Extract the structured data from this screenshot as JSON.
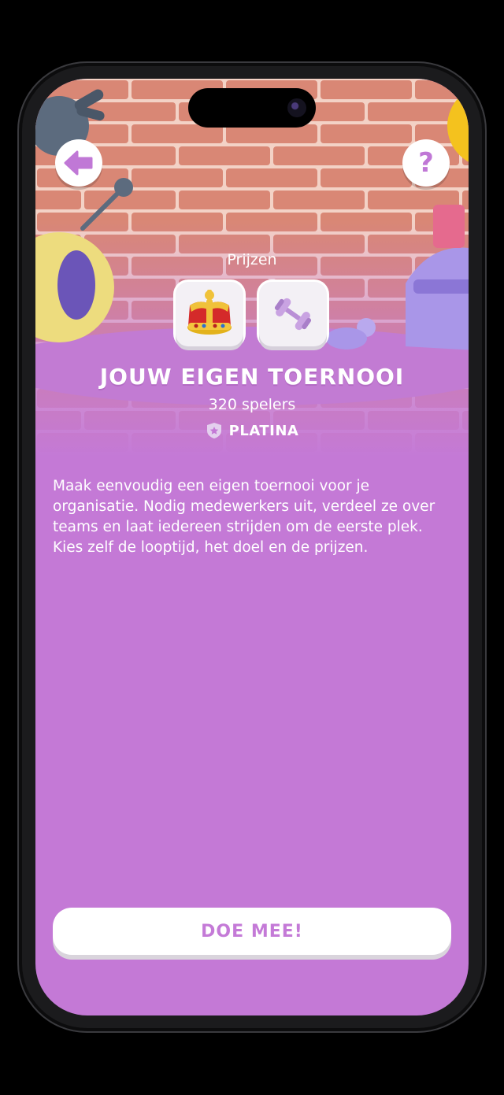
{
  "header": {
    "back_icon": "arrow-left-icon",
    "help_label": "?"
  },
  "prizes": {
    "label": "Prijzen",
    "items": [
      {
        "icon": "crown-icon"
      },
      {
        "icon": "dumbbell-icon"
      }
    ]
  },
  "tournament": {
    "title": "JOUW EIGEN TOERNOOI",
    "players": "320 spelers",
    "level": "PLATINA",
    "level_icon": "shield-star-icon",
    "description": "Maak eenvoudig een eigen toernooi voor je organisatie. Nodig medewerkers uit, verdeel ze over teams en laat iedereen strijden om de eerste plek. Kies zelf de looptijd, het doel en de prijzen."
  },
  "cta": {
    "label": "DOE MEE!"
  },
  "colors": {
    "background": "#c479d6",
    "accent": "#c47ad7",
    "brick": "#d98a78",
    "mortar": "#f1cbbf"
  }
}
